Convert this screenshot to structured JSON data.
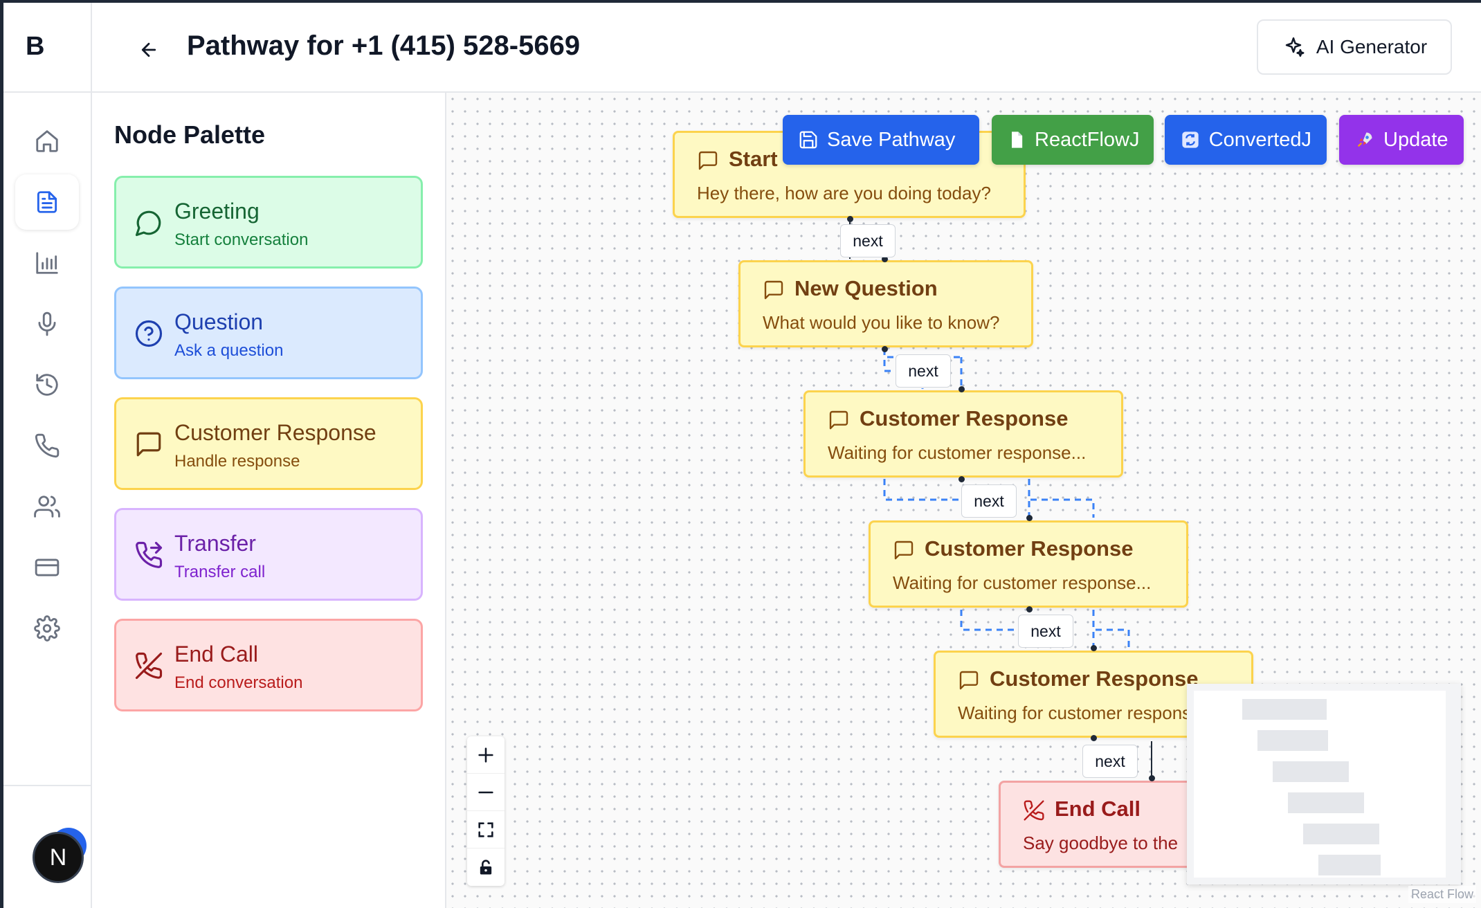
{
  "app": {
    "logo": "B",
    "page_title": "Pathway for +1 (415) 528-5669",
    "ai_generator_label": "AI Generator",
    "avatar_initial": "N"
  },
  "sidebar": {
    "items": [
      {
        "name": "home",
        "icon": "home-icon",
        "active": false
      },
      {
        "name": "pathways",
        "icon": "file-text-icon",
        "active": true
      },
      {
        "name": "analytics",
        "icon": "bar-chart-icon",
        "active": false
      },
      {
        "name": "voice",
        "icon": "microphone-icon",
        "active": false
      },
      {
        "name": "history",
        "icon": "history-icon",
        "active": false
      },
      {
        "name": "calls",
        "icon": "phone-icon",
        "active": false
      },
      {
        "name": "contacts",
        "icon": "users-icon",
        "active": false
      },
      {
        "name": "billing",
        "icon": "credit-card-icon",
        "active": false
      },
      {
        "name": "settings",
        "icon": "gear-icon",
        "active": false
      }
    ]
  },
  "palette": {
    "title": "Node Palette",
    "items": [
      {
        "label": "Greeting",
        "sub": "Start conversation",
        "icon": "message-circle-icon",
        "bg": "#dcfce7",
        "border": "#86efac",
        "color": "#166534"
      },
      {
        "label": "Question",
        "sub": "Ask a question",
        "icon": "help-circle-icon",
        "bg": "#dbeafe",
        "border": "#93c5fd",
        "color": "#1e40af"
      },
      {
        "label": "Customer Response",
        "sub": "Handle response",
        "icon": "message-square-icon",
        "bg": "#fef9c3",
        "border": "#fcd34d",
        "color": "#713f12"
      },
      {
        "label": "Transfer",
        "sub": "Transfer call",
        "icon": "phone-forwarded-icon",
        "bg": "#f3e8ff",
        "border": "#d8b4fe",
        "color": "#6b21a8"
      },
      {
        "label": "End Call",
        "sub": "End conversation",
        "icon": "phone-off-icon",
        "bg": "#fee2e2",
        "border": "#fca5a5",
        "color": "#991b1b"
      }
    ]
  },
  "toolbar": {
    "buttons": [
      {
        "label": "Save Pathway",
        "icon": "save-icon",
        "color": "#2563eb"
      },
      {
        "label": "ReactFlowJ",
        "icon": "document-icon",
        "color": "#43a047"
      },
      {
        "label": "ConvertedJ",
        "icon": "convert-icon",
        "color": "#2563eb"
      },
      {
        "label": "Update",
        "icon": "rocket-icon",
        "color": "#9333ea"
      }
    ]
  },
  "flow": {
    "nodes": [
      {
        "title": "Start",
        "text": "Hey there, how are you doing today?",
        "type": "start"
      },
      {
        "title": "New Question",
        "text": "What would you like to know?",
        "type": "question"
      },
      {
        "title": "Customer Response",
        "text": "Waiting for customer response...",
        "type": "response"
      },
      {
        "title": "Customer Response",
        "text": "Waiting for customer response...",
        "type": "response"
      },
      {
        "title": "Customer Response",
        "text": "Waiting for customer response...",
        "type": "response"
      },
      {
        "title": "End Call",
        "text": "Say goodbye to the",
        "type": "end"
      }
    ],
    "edge_labels": [
      "next",
      "next",
      "next",
      "next",
      "next"
    ]
  },
  "attribution": "React Flow"
}
